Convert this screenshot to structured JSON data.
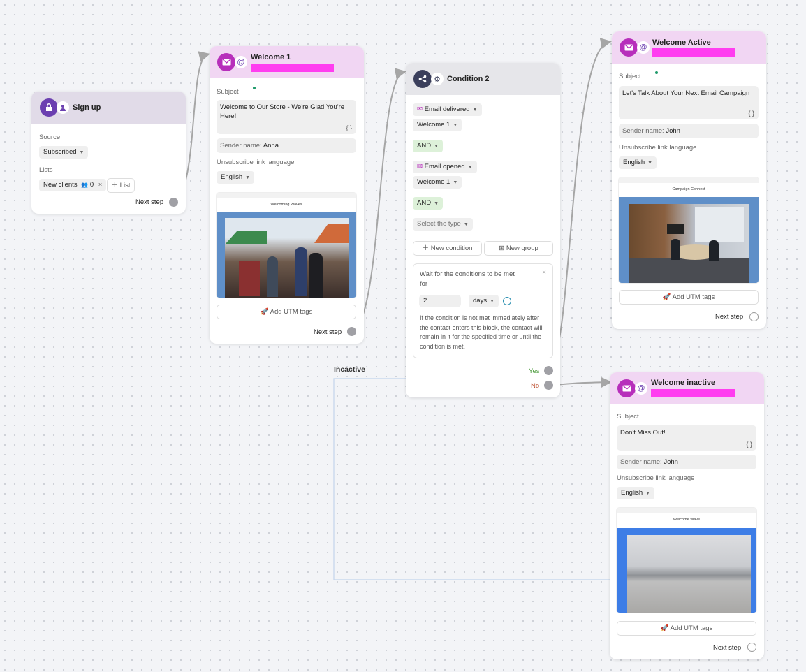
{
  "signup": {
    "title": "Sign up",
    "source_label": "Source",
    "source_value": "Subscribed",
    "lists_label": "Lists",
    "list_chip": "New clients",
    "list_count": "0",
    "add_list": "List",
    "next_step": "Next step"
  },
  "welcome1": {
    "title": "Welcome 1",
    "subject_label": "Subject",
    "subject": "Welcome to Our Store - We're Glad You're Here!",
    "curly": "{ }",
    "sender_label": "Sender name:",
    "sender": "Anna",
    "unsub_label": "Unsubscribe link language",
    "lang": "English",
    "preview_caption": "Welcoming Waves",
    "utm": "Add UTM tags",
    "next_step": "Next step"
  },
  "condition": {
    "title": "Condition 2",
    "c1_event": "Email delivered",
    "c1_email": "Welcome 1",
    "and1": "AND",
    "c2_event": "Email opened",
    "c2_email": "Welcome 1",
    "and2": "AND",
    "select_type": "Select the type",
    "new_condition": "New condition",
    "new_group": "New group",
    "wait_text": "Wait for the conditions to be met for",
    "wait_value": "2",
    "wait_unit": "days",
    "wait_note": "If the condition is not met immediately after the contact enters this block, the contact will remain in it for the specified time or until the condition is met.",
    "yes": "Yes",
    "no": "No"
  },
  "active": {
    "title": "Welcome Active",
    "subject_label": "Subject",
    "subject": "Let's Talk About Your Next Email Campaign",
    "curly": "{ }",
    "sender_label": "Sender name:",
    "sender": "John",
    "unsub_label": "Unsubscribe link language",
    "lang": "English",
    "preview_caption": "Campaign Connect",
    "utm": "Add UTM tags",
    "next_step": "Next step"
  },
  "inactive": {
    "title": "Welcome inactive",
    "subject_label": "Subject",
    "subject": "Don't Miss Out!",
    "curly": "{ }",
    "sender_label": "Sender name:",
    "sender": "John",
    "unsub_label": "Unsubscribe link language",
    "lang": "English",
    "preview_caption": "Welcome Wave",
    "utm": "Add UTM tags",
    "next_step": "Next step"
  },
  "edge_label_inactive": "Incactive",
  "colors": {
    "header_pink": "#f1d6f3",
    "redaction": "#ff3df0",
    "email_icon": "#b72fbb",
    "signup_icon": "#6b3fb0",
    "condition_icon": "#3b3f5c",
    "and_green": "#ddf1d9",
    "yes_green": "#4a9a3a",
    "no_red": "#c0583a",
    "wire_gray": "#a6a6a6",
    "wire_blue": "#c2d4ec"
  }
}
